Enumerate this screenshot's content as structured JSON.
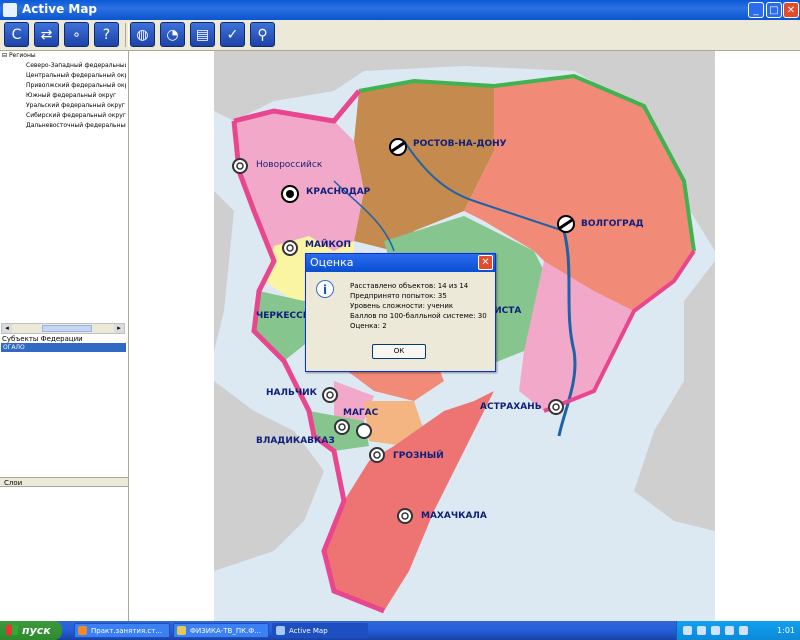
{
  "window": {
    "title": "Active Map",
    "min_icon": "minimize-icon",
    "max_icon": "maximize-icon",
    "close_icon": "close-icon"
  },
  "toolbar": {
    "buttons": [
      {
        "icon": "refresh-icon",
        "glyph": "C"
      },
      {
        "icon": "swap-icon",
        "glyph": "⇄"
      },
      {
        "icon": "network-icon",
        "glyph": "∘"
      },
      {
        "icon": "help-icon",
        "glyph": "?"
      },
      {
        "icon": "globe-icon",
        "glyph": "◍"
      },
      {
        "icon": "clock-icon",
        "glyph": "◔"
      },
      {
        "icon": "document-icon",
        "glyph": "▤"
      },
      {
        "icon": "check-icon",
        "glyph": "✓"
      },
      {
        "icon": "zoom-icon",
        "glyph": "⚲"
      }
    ]
  },
  "left_panel": {
    "tree_root": "Регионы",
    "tree_items": [
      "Северо-Западный федеральный",
      "Центральный федеральный округ",
      "Приволжский федеральный округ",
      "Южный федеральный округ",
      "Уральский федеральный округ",
      "Сибирский федеральный округ",
      "Дальневосточный федеральный"
    ],
    "federation_label": "Субъекты Федерации",
    "selected_item": "ОГАЛО",
    "layers_label": "Слои"
  },
  "map": {
    "colors": {
      "sea": "#DCE9F3",
      "land_gray": "#CFCFCF",
      "brown": "#C48A4E",
      "salmon": "#F28A78",
      "pink": "#F2A9C9",
      "green": "#87C58F",
      "yellow": "#FAF5A2",
      "red": "#EE7373",
      "orange": "#F5B583",
      "border_pink": "#E8478F",
      "border_green": "#3FB34F",
      "river": "#1D63A6"
    },
    "cities": [
      {
        "label": "РОСТОВ-НА-ДОНУ",
        "kind": "capital"
      },
      {
        "label": "Новороссийск",
        "kind": "town"
      },
      {
        "label": "КРАСНОДАР",
        "kind": "main"
      },
      {
        "label": "ВОЛГОГРАД",
        "kind": "capital"
      },
      {
        "label": "МАЙКОП",
        "kind": "town"
      },
      {
        "label": "ЧЕРКЕССК",
        "kind": "none"
      },
      {
        "label": "ЭЛИСТА",
        "kind": "none"
      },
      {
        "label": "АСТРАХАНЬ",
        "kind": "town"
      },
      {
        "label": "НАЛЬЧИК",
        "kind": "town"
      },
      {
        "label": "МАГАС",
        "kind": "town"
      },
      {
        "label": "ВЛАДИКАВКАЗ",
        "kind": "town"
      },
      {
        "label": "ГРОЗНЫЙ",
        "kind": "town"
      },
      {
        "label": "МАХАЧКАЛА",
        "kind": "town"
      }
    ]
  },
  "dialog": {
    "title": "Оценка",
    "icon": "info-icon",
    "lines": [
      "Расставлено объектов: 14 из 14",
      "Предпринято попыток: 35",
      "Уровень сложности: ученик",
      "Баллов по 100-балльной системе: 30",
      "Оценка: 2"
    ],
    "ok_label": "ОК"
  },
  "taskbar": {
    "start_label": "пуск",
    "tasks": [
      {
        "label": "Практ.занятия.ст...",
        "icon_color": "#F08A2A"
      },
      {
        "label": "ФИЗИКА-ТВ_ПК.Ф...",
        "icon_color": "#E4C85A"
      },
      {
        "label": "Active Map",
        "icon_color": "#A7C7FF"
      }
    ],
    "clock": "1:01"
  }
}
